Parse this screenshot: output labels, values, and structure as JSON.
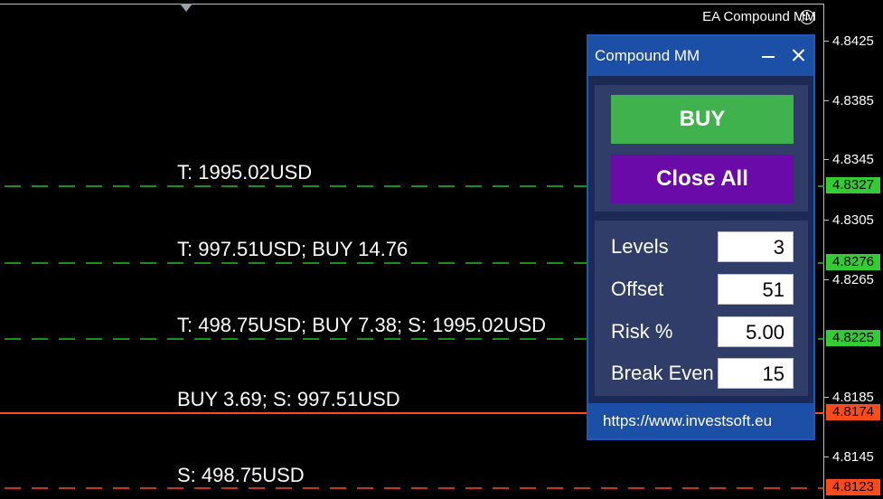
{
  "chart": {
    "ea_label": "EA Compound MM",
    "smiley_icon": "smiley-icon",
    "price_ticks": [
      "4.8425",
      "4.8385",
      "4.8345",
      "4.8305",
      "4.8265",
      "4.8185",
      "4.8145"
    ],
    "price_flags": [
      {
        "value": "4.8327",
        "color": "#33cc33"
      },
      {
        "value": "4.8276",
        "color": "#33cc33"
      },
      {
        "value": "4.8225",
        "color": "#33cc33"
      },
      {
        "value": "4.8174",
        "color": "#ff4a1a"
      },
      {
        "value": "4.8123",
        "color": "#ff4a1a"
      }
    ],
    "lines": [
      {
        "label": "T: 1995.02USD",
        "color": "#1ec21e",
        "style": "dashed"
      },
      {
        "label": "T: 997.51USD; BUY  14.76",
        "color": "#1ec21e",
        "style": "dashed"
      },
      {
        "label": "T: 498.75USD; BUY  7.38; S: 1995.02USD",
        "color": "#1ec21e",
        "style": "dashed"
      },
      {
        "label": "BUY 3.69; S: 997.51USD",
        "color": "#ff4a1a",
        "style": "solid"
      },
      {
        "label": "S: 498.75USD",
        "color": "#ff4a1a",
        "style": "dashed"
      }
    ]
  },
  "panel": {
    "title": "Compound MM",
    "minimize_icon": "minimize-icon",
    "close_icon": "close-icon",
    "buy_label": "BUY",
    "close_all_label": "Close All",
    "fields": [
      {
        "label": "Levels",
        "value": "3"
      },
      {
        "label": "Offset",
        "value": "51"
      },
      {
        "label": "Risk %",
        "value": "5.00"
      },
      {
        "label": "Break Even",
        "value": "15"
      }
    ],
    "url": "https://www.investsoft.eu",
    "colors": {
      "buy": "#3fb24e",
      "close_all": "#6a0aa8",
      "titlebar": "#1c4fa6"
    }
  }
}
